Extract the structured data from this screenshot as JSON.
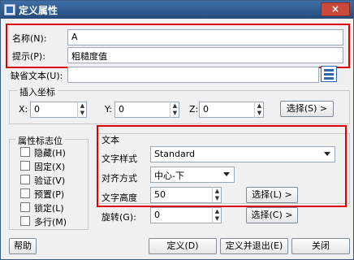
{
  "window": {
    "title": "定义属性",
    "close_label": "×"
  },
  "attribute": {
    "name_label": "名称(N):",
    "name_value": "A",
    "prompt_label": "提示(P):",
    "prompt_value": "粗糙度值",
    "default_label": "缺省文本(U):",
    "default_value": ""
  },
  "insert": {
    "title": "插入坐标",
    "x_label": "X:",
    "x_value": "0",
    "y_label": "Y:",
    "y_value": "0",
    "z_label": "Z:",
    "z_value": "0",
    "pick_label": "选择(S) >"
  },
  "flags": {
    "title": "属性标志位",
    "items": [
      {
        "label": "隐藏(H)"
      },
      {
        "label": "固定(X)"
      },
      {
        "label": "验证(V)"
      },
      {
        "label": "预置(P)"
      },
      {
        "label": "锁定(L)"
      },
      {
        "label": "多行(M)"
      }
    ]
  },
  "text": {
    "title": "文本",
    "style_label": "文字样式",
    "style_value": "Standard",
    "align_label": "对齐方式",
    "align_value": "中心-下",
    "height_label": "文字高度",
    "height_value": "50",
    "height_pick_label": "选择(L) >",
    "rotation_label": "旋转(G):",
    "rotation_value": "0",
    "rotation_pick_label": "选择(C) >"
  },
  "footer": {
    "help_label": "帮助",
    "ok_label": "定义(D)",
    "ok_exit_label": "定义并退出(E)",
    "close_label": "关闭"
  },
  "colors": {
    "highlight": "#e00000",
    "title_bar": "#2f5f95"
  },
  "icons": [
    "app-icon",
    "close-icon",
    "pick-point-icon",
    "spinner-up-icon",
    "spinner-down-icon",
    "dropdown-arrow-icon"
  ]
}
